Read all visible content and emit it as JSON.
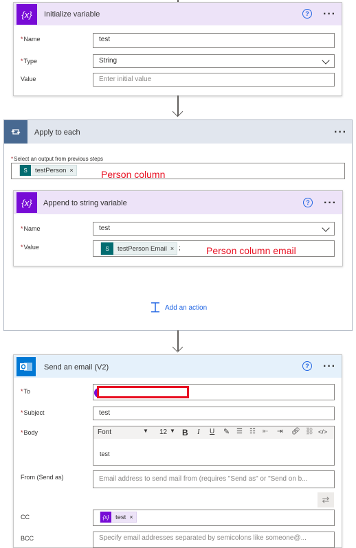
{
  "init_var": {
    "title": "Initialize variable",
    "name_label": "Name",
    "name_value": "test",
    "type_label": "Type",
    "type_value": "String",
    "value_label": "Value",
    "value_placeholder": "Enter initial value"
  },
  "apply_each": {
    "title": "Apply to each",
    "select_label": "Select an output from previous steps",
    "token_label": "testPerson",
    "annotation": "Person column"
  },
  "append": {
    "title": "Append to string variable",
    "name_label": "Name",
    "name_value": "test",
    "value_label": "Value",
    "token_label": "testPerson Email",
    "trailing_text": ";",
    "annotation": "Person column email"
  },
  "add_action": {
    "label": "Add an action"
  },
  "email": {
    "title": "Send an email (V2)",
    "to_label": "To",
    "subject_label": "Subject",
    "subject_value": "test",
    "body_label": "Body",
    "font_label": "Font",
    "font_size": "12",
    "body_value": "test",
    "from_label": "From (Send as)",
    "from_placeholder": "Email address to send mail from (requires \"Send as\" or \"Send on b...",
    "cc_label": "CC",
    "cc_token": "test",
    "bcc_label": "BCC",
    "bcc_placeholder": "Specify email addresses separated by semicolons like someone@..."
  },
  "common": {
    "required_mark": "*",
    "help_glyph": "?",
    "more_glyph": "···",
    "close_glyph": "×",
    "var_icon_glyph": "{x}",
    "bold_glyph": "B",
    "italic_glyph": "I",
    "underline_glyph": "U",
    "code_glyph": "</>"
  },
  "colors": {
    "variable_purple": "#770bd6",
    "variable_header_bg": "#ede3f8",
    "loop_blue": "#486991",
    "loop_header_bg": "#e1e6ee",
    "outlook_blue": "#0078d4",
    "outlook_header_bg": "#e5f1fb",
    "annotation_red": "#e81123",
    "sharepoint_teal": "#036c70"
  }
}
